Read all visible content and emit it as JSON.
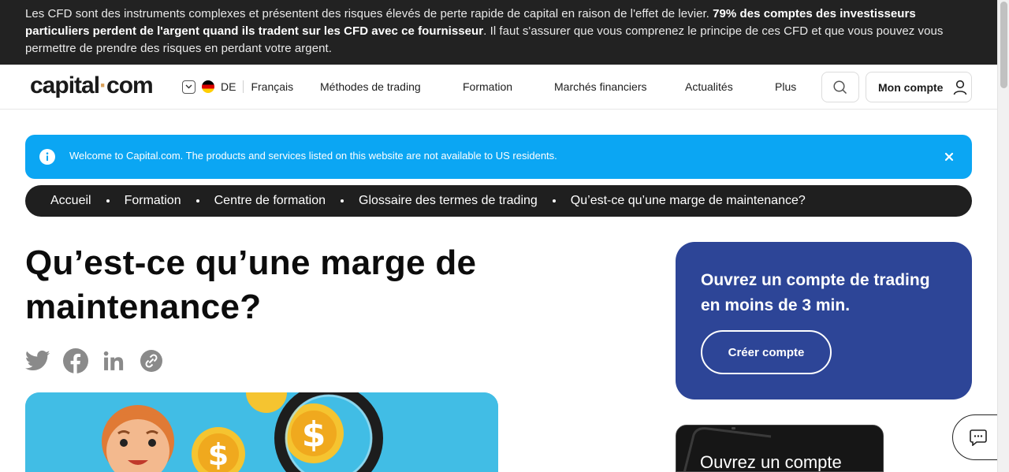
{
  "risk_banner": {
    "text_before": "Les CFD sont des instruments complexes et présentent des risques élevés de perte rapide de capital en raison de l'effet de levier. ",
    "text_bold": "79% des comptes des investisseurs particuliers perdent de l'argent quand ils tradent sur les CFD avec ce fournisseur",
    "text_after": ". Il faut s'assurer que vous comprenez le principe de ces CFD et que vous pouvez vous permettre de prendre des risques en perdant votre argent."
  },
  "header": {
    "logo_left": "capital",
    "logo_dot": "·",
    "logo_right": "com",
    "country_code": "DE",
    "language": "Français",
    "nav": [
      "Méthodes de trading",
      "Formation",
      "Marchés financiers",
      "Actualités",
      "Plus"
    ],
    "account_label": "Mon compte"
  },
  "notice": {
    "text": "Welcome to Capital.com. The products and services listed on this website are not available to US residents."
  },
  "breadcrumb": [
    "Accueil",
    "Formation",
    "Centre de formation",
    "Glossaire des termes de trading",
    "Qu’est-ce qu’une marge de maintenance?"
  ],
  "article": {
    "title": "Qu’est-ce qu’une marge de maintenance?"
  },
  "share_icons": [
    "twitter-icon",
    "facebook-icon",
    "linkedin-icon",
    "copy-link-icon"
  ],
  "cta": {
    "title": "Ouvrez un compte de trading en moins de 3 min.",
    "button": "Créer compte"
  },
  "promo": {
    "text": "Ouvrez un compte"
  },
  "colors": {
    "risk_bg": "#222222",
    "notice_bg": "#0ba6f3",
    "breadcrumb_bg": "#1f1f1f",
    "cta_bg": "#2d4597",
    "logo_dot": "#d9a05b",
    "hero_bg": "#41bde5"
  }
}
